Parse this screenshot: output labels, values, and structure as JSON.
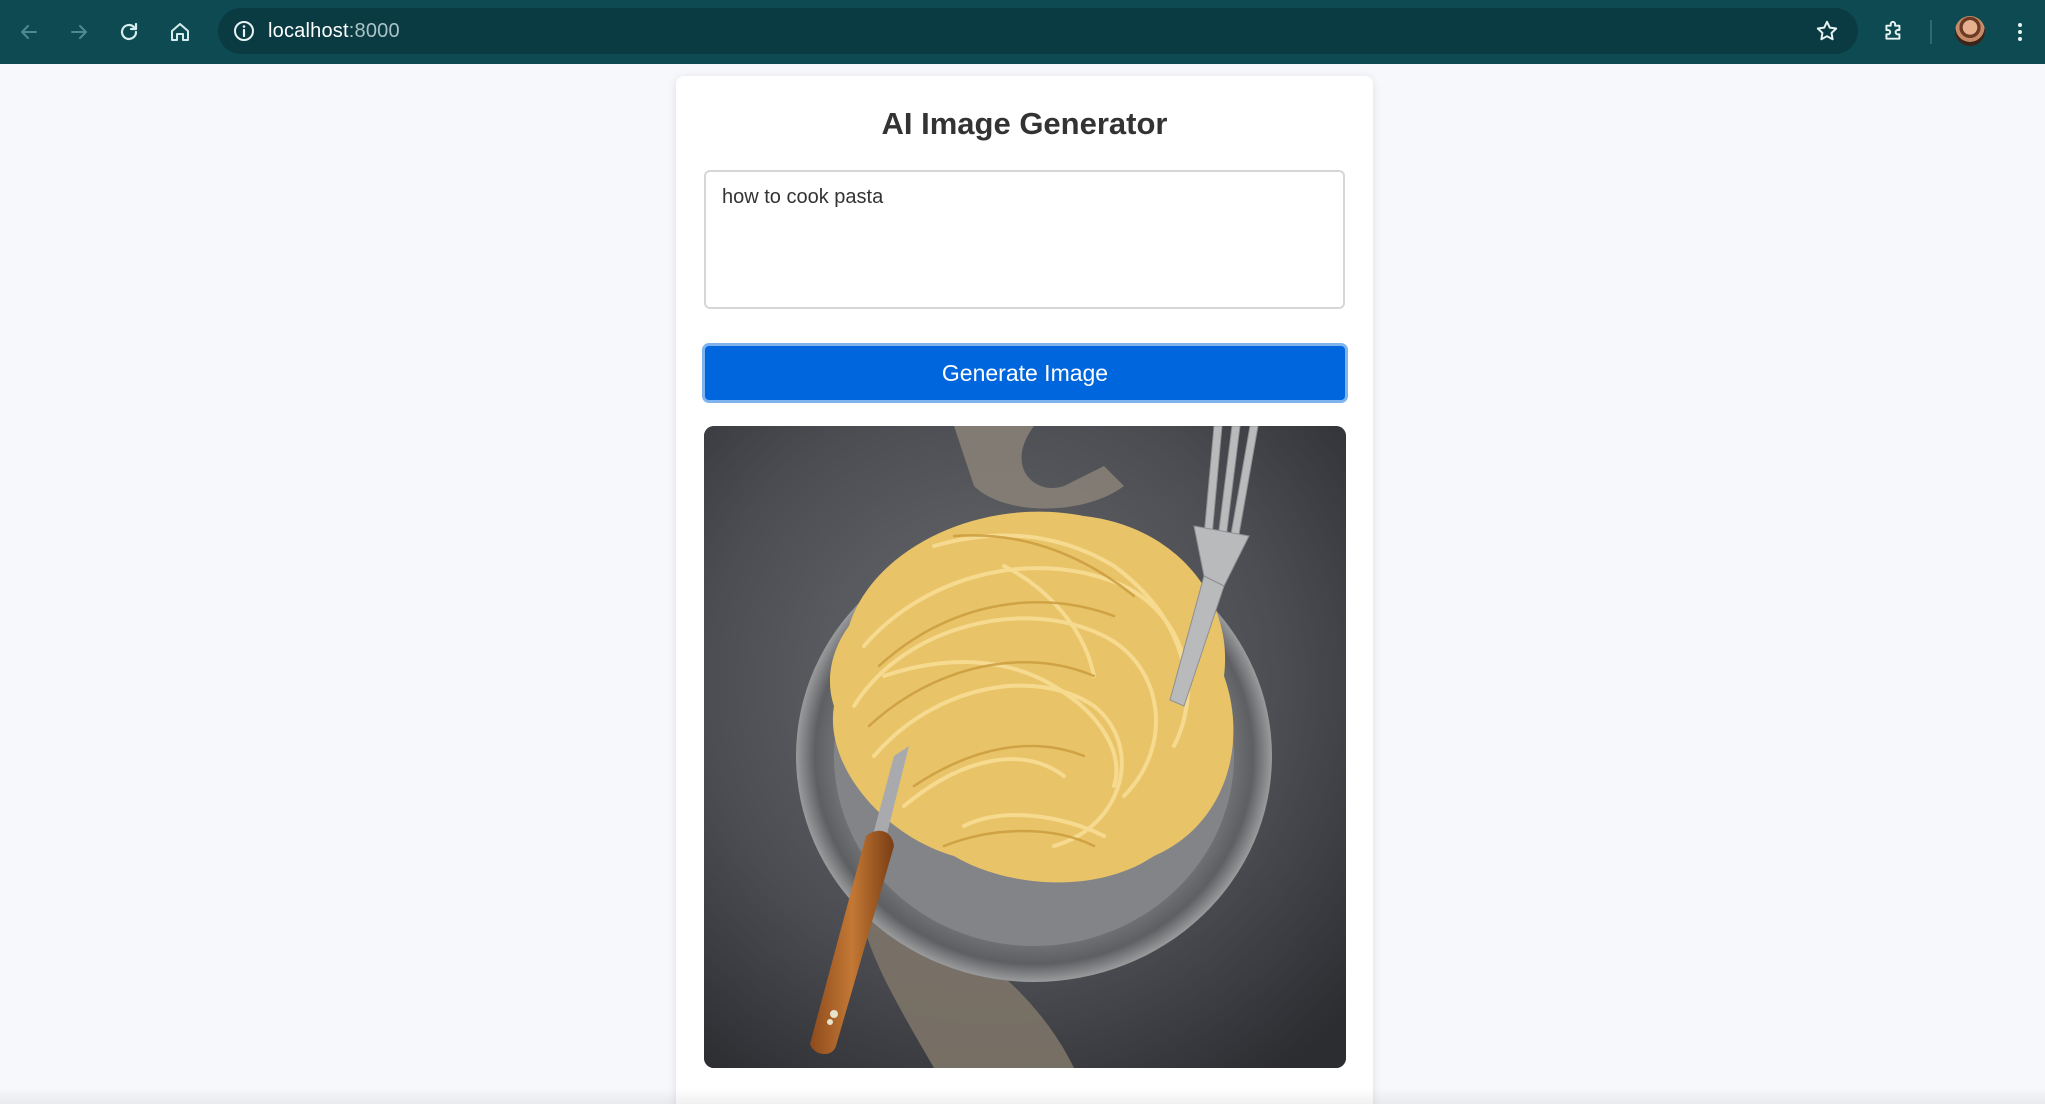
{
  "browser": {
    "url_host": "localhost",
    "url_port": ":8000",
    "icons": {
      "back": "arrow-left-icon",
      "forward": "arrow-right-icon",
      "reload": "reload-icon",
      "home": "home-icon",
      "site_info": "info-icon",
      "bookmark": "star-icon",
      "extensions": "puzzle-icon",
      "profile": "avatar",
      "menu": "kebab-menu-icon"
    },
    "colors": {
      "toolbar": "#0d4a52",
      "omnibox": "#0a3b42"
    }
  },
  "page": {
    "title": "AI Image Generator",
    "prompt_value": "how to cook pasta",
    "generate_label": "Generate Image",
    "result_image": "generated-pasta-image",
    "colors": {
      "button": "#0066dd",
      "background": "#f7f8fc"
    }
  }
}
